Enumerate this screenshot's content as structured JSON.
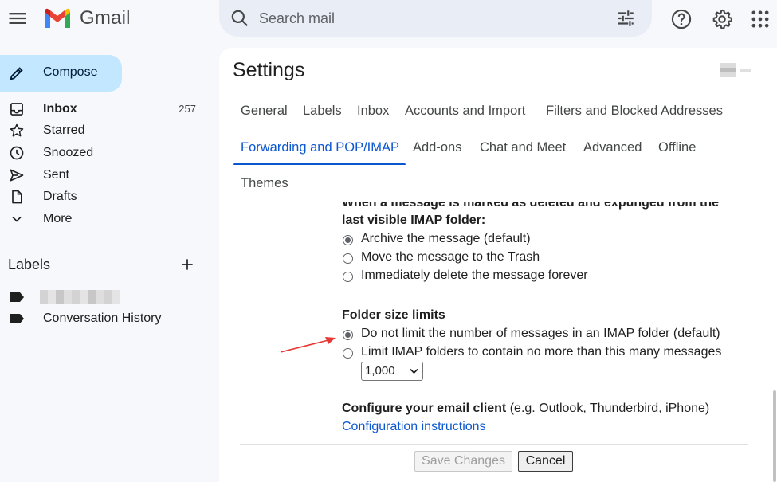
{
  "app": {
    "name": "Gmail"
  },
  "search": {
    "placeholder": "Search mail"
  },
  "sidebar": {
    "compose_label": "Compose",
    "items": [
      {
        "label": "Inbox",
        "count": "257"
      },
      {
        "label": "Starred"
      },
      {
        "label": "Snoozed"
      },
      {
        "label": "Sent"
      },
      {
        "label": "Drafts"
      },
      {
        "label": "More"
      }
    ],
    "labels_heading": "Labels",
    "labels": [
      {
        "label": ""
      },
      {
        "label": "Conversation History"
      }
    ]
  },
  "settings": {
    "title": "Settings",
    "tabs": [
      {
        "label": "General"
      },
      {
        "label": "Labels"
      },
      {
        "label": "Inbox"
      },
      {
        "label": "Accounts and Import"
      },
      {
        "label": "Filters and Blocked Addresses"
      },
      {
        "label": "Forwarding and POP/IMAP",
        "active": true
      },
      {
        "label": "Add-ons"
      },
      {
        "label": "Chat and Meet"
      },
      {
        "label": "Advanced"
      },
      {
        "label": "Offline"
      },
      {
        "label": "Themes"
      }
    ]
  },
  "imap": {
    "expunge_heading_line1": "When a message is marked as deleted and expunged from the",
    "expunge_heading_line2": "last visible IMAP folder:",
    "expunge_options": [
      {
        "label": "Archive the message (default)",
        "checked": true
      },
      {
        "label": "Move the message to the Trash",
        "checked": false
      },
      {
        "label": "Immediately delete the message forever",
        "checked": false
      }
    ],
    "folder_heading": "Folder size limits",
    "folder_options": [
      {
        "label": "Do not limit the number of messages in an IMAP folder (default)",
        "checked": true
      },
      {
        "label": "Limit IMAP folders to contain no more than this many messages",
        "checked": false
      }
    ],
    "limit_value": "1,000",
    "client_heading": "Configure your email client",
    "client_note": " (e.g. Outlook, Thunderbird, iPhone)",
    "client_link": "Configuration instructions"
  },
  "actions": {
    "save_label": "Save Changes",
    "cancel_label": "Cancel"
  },
  "colors": {
    "accent": "#0b57d0",
    "compose_bg": "#c2e7ff",
    "annotation_arrow": "#e53935"
  }
}
